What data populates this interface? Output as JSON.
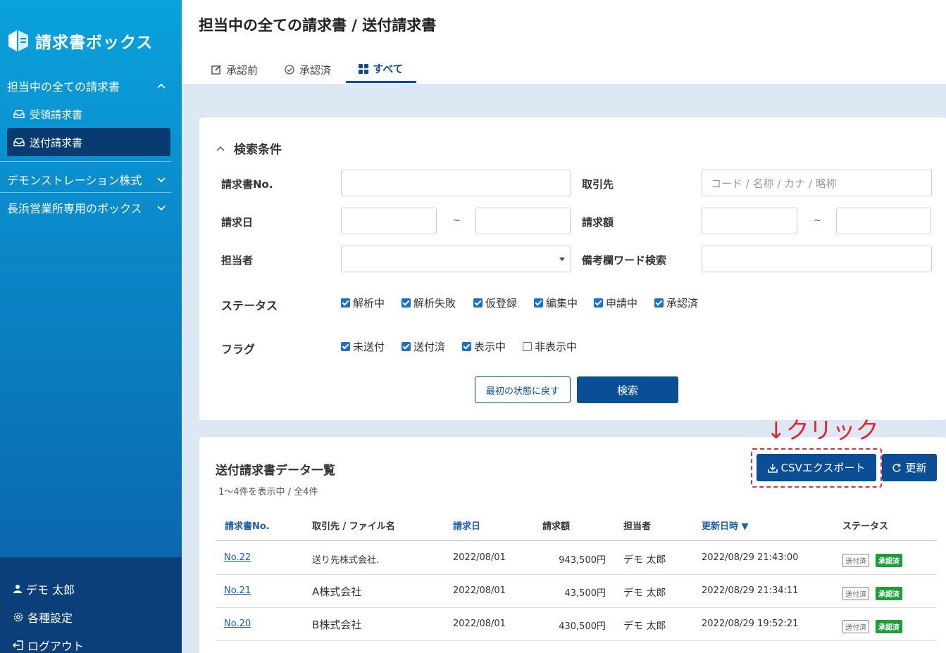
{
  "app": {
    "name": "請求書ボックス"
  },
  "sidebar": {
    "group1": {
      "label": "担当中の全ての請求書"
    },
    "items": [
      {
        "label": "受領請求書"
      },
      {
        "label": "送付請求書"
      }
    ],
    "group2": {
      "label": "デモンストレーション株式"
    },
    "group3": {
      "label": "長浜営業所専用のボックス"
    },
    "user": {
      "label": "デモ 太郎"
    },
    "settings": {
      "label": "各種設定"
    },
    "logout": {
      "label": "ログアウト"
    }
  },
  "header": {
    "title": "担当中の全ての請求書 / 送付請求書",
    "tabs": [
      {
        "label": "承認前"
      },
      {
        "label": "承認済"
      },
      {
        "label": "すべて"
      }
    ]
  },
  "search": {
    "title": "検索条件",
    "invoice_no_label": "請求書No.",
    "partner_label": "取引先",
    "partner_placeholder": "コード / 名称 / カナ / 略称",
    "date_label": "請求日",
    "amount_label": "請求額",
    "tilde": "~",
    "assignee_label": "担当者",
    "memo_label": "備考欄ワード検索",
    "status_label": "ステータス",
    "statuses": [
      {
        "label": "解析中",
        "checked": true
      },
      {
        "label": "解析失敗",
        "checked": true
      },
      {
        "label": "仮登録",
        "checked": true
      },
      {
        "label": "編集中",
        "checked": true
      },
      {
        "label": "申請中",
        "checked": true
      },
      {
        "label": "承認済",
        "checked": true
      }
    ],
    "flag_label": "フラグ",
    "flags": [
      {
        "label": "未送付",
        "checked": true
      },
      {
        "label": "送付済",
        "checked": true
      },
      {
        "label": "表示中",
        "checked": true
      },
      {
        "label": "非表示中",
        "checked": false
      }
    ],
    "reset_label": "最初の状態に戻す",
    "search_label": "検索"
  },
  "list": {
    "title": "送付請求書データ一覧",
    "count": "1〜4件を表示中 / 全4件",
    "csv_label": "CSVエクスポート",
    "refresh_label": "更新",
    "columns": [
      "請求書No.",
      "取引先 / ファイル名",
      "請求日",
      "請求額",
      "担当者",
      "更新日時 ▼",
      "ステータス"
    ],
    "rows": [
      {
        "no": "No.22",
        "partner": "送り先株式会社.",
        "date": "2022/08/01",
        "amount": "943,500円",
        "assignee": "デモ 太郎",
        "updated": "2022/08/29 21:43:00",
        "flag": "送付済",
        "status": "承認済"
      },
      {
        "no": "No.21",
        "partner": "A株式会社",
        "date": "2022/08/01",
        "amount": "43,500円",
        "assignee": "デモ 太郎",
        "updated": "2022/08/29 21:34:11",
        "flag": "送付済",
        "status": "承認済"
      },
      {
        "no": "No.20",
        "partner": "B株式会社",
        "date": "2022/08/01",
        "amount": "430,500円",
        "assignee": "デモ 太郎",
        "updated": "2022/08/29 19:52:21",
        "flag": "送付済",
        "status": "承認済"
      }
    ]
  },
  "annotation": {
    "text": "↓クリック",
    "color": "#e8212e"
  },
  "colors": {
    "primary": "#0a4f96",
    "sidebar_active": "#083b70",
    "approved": "#1e9e3a"
  }
}
